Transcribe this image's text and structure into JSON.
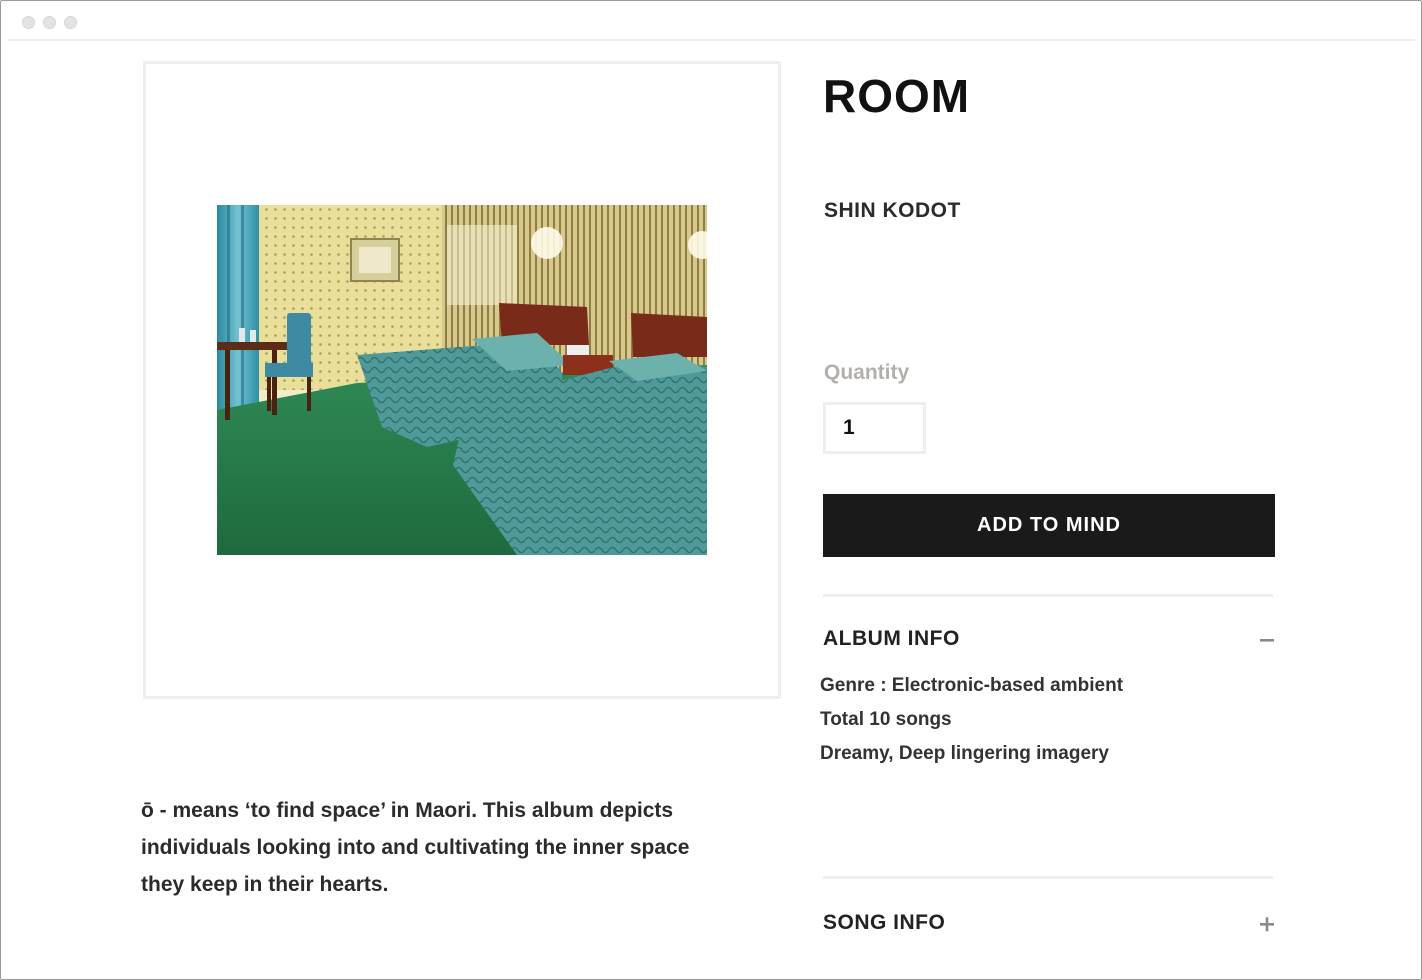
{
  "window": {
    "controls": [
      "close",
      "minimize",
      "zoom"
    ]
  },
  "product": {
    "title": "ROOM",
    "artist": "SHIN KODOT",
    "image": "hotel-room-photo"
  },
  "purchase": {
    "quantity_label": "Quantity",
    "quantity_value": "1",
    "add_button_label": "ADD TO MIND"
  },
  "album_info": {
    "title": "ALBUM INFO",
    "expanded": true,
    "toggle_icon": "minus-icon",
    "lines": [
      "Genre : Electronic-based ambient",
      "Total 10 songs",
      "Dreamy, Deep lingering imagery"
    ]
  },
  "song_info": {
    "title": "SONG INFO",
    "expanded": false,
    "toggle_icon": "plus-icon"
  },
  "description": "ō - means ‘to find space’ in Maori. This album depicts individuals looking into and cultivating the inner space they keep in their hearts.",
  "colors": {
    "button_bg": "#1a1a1a",
    "button_text": "#ffffff",
    "muted_label": "#b3b0ab",
    "divider": "#eeeeee",
    "text": "#2b2b2b"
  }
}
